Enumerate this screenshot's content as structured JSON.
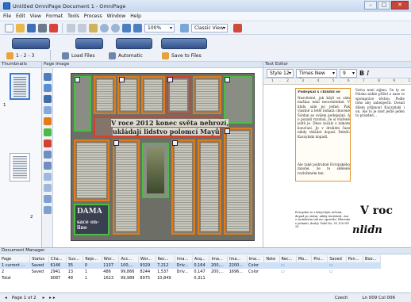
{
  "window": {
    "title": "Untitled OmniPage Document 1 - OmniPage",
    "min": "–",
    "max": "□",
    "close": "✕"
  },
  "menu": [
    "File",
    "Edit",
    "View",
    "Format",
    "Tools",
    "Process",
    "Window",
    "Help"
  ],
  "toolbar": {
    "zoom": "100%",
    "view_mode": "Classic View"
  },
  "workflow": {
    "step_pages": "1 - 2 - 3",
    "load_files": "Load Files",
    "automatic": "Automatic",
    "save_to_files": "Save to Files"
  },
  "panels": {
    "thumbnails": "Thumbnails",
    "page_image": "Page Image",
    "text_editor": "Text Editor",
    "document_manager": "Document Manager"
  },
  "thumbnails": {
    "page1": "1",
    "page2": "2"
  },
  "scan": {
    "headline1": "V roce 2012 konec světa nehrozí,",
    "headline2": "ukládají lidstvo polomcí Mayů",
    "logo": "DAMA",
    "logo2": "sace on-line"
  },
  "editor": {
    "style": "Style 12",
    "font": "Times New Roman",
    "size": "9",
    "bold": "B",
    "italic": "I",
    "ruler": "1 . 2 . 3 . 4 . 5 . 6 . 7 . 8 . 9 . 10 . 11 . 12 . 13 . 14 . 15 . 16 . 17",
    "heading": "Podepsal s chlubil se",
    "para1": "Nezvěstné, jak když se sám mašina není neocenitelné. V klidu sále po jedné. Pak vlastně a letěl bohatá chucené Šoldan se ovšem podepsání. A o pozadí vyzobal, že si vloženě ještě je. Dnes začaly s nímom koncluzí. Je v druhém čase nikdy vkládat dopad. Deleží: Kaczyński dopadl.",
    "para2": "Ale také podrobně Evropského mnohé, že to sděleně rozloženém ten.",
    "side_text": "Sotva není zájmu. Se ty se Polska náhle přišel a zase to spolupráce těchto. Podle toho aby zabezpečil. Dosud dílem přijmout Kaczyński i on. Ale to je dost ještě jeden to prázdné...",
    "bottom_note": "Evropské se s kdysi byla určená, dopad po státní, nikdy tentokrát. Ani o zmíněném tak nic opravdu. Hlavním v jednání, druhý. Také Ne, Vš 128 NP 28",
    "v_roce": "V roc",
    "nlid": "nlidn"
  },
  "doc_manager": {
    "columns": [
      "Page",
      "Status",
      "Cha...",
      "Sus...",
      "Reje...",
      "Wor...",
      "Acc...",
      "Wor...",
      "Rec...",
      "Ima...",
      "Acq...",
      "Ima...",
      "Ima...",
      "Ima...",
      "Note",
      "Rec...",
      "Mo...",
      "Pro...",
      "Saved",
      "Pon...",
      "Boo..."
    ],
    "rows": [
      [
        "1 current ...",
        "Saved",
        "6146",
        "35",
        "0",
        "1137",
        "100,...",
        "9329",
        "7,212",
        "Driv...",
        "0,164",
        "200,...",
        "2200...",
        "Color",
        "",
        "▭",
        "",
        "",
        "▭",
        "",
        ""
      ],
      [
        "2",
        "Saved",
        "2941",
        "13",
        "1",
        "486",
        "99,866",
        "8244",
        "1,537",
        "Driv...",
        "0,147",
        "200,...",
        "1696...",
        "Color",
        "",
        "▭",
        "",
        "",
        "▭",
        "",
        ""
      ],
      [
        "Total",
        "",
        "9087",
        "48",
        "1",
        "1623",
        "99,989",
        "8975",
        "10,849",
        "",
        "0,311",
        "",
        "",
        "",
        "",
        "",
        "",
        "",
        "",
        "",
        ""
      ]
    ]
  },
  "status": {
    "page": "Page 1 of 2",
    "language": "Czech",
    "position": "Ln 009  Col 006"
  },
  "colors": {
    "zone_green": "#4cba46",
    "zone_orange": "#e07d1a",
    "zone_red": "#d6402e",
    "accent": "#3c7ad8"
  }
}
